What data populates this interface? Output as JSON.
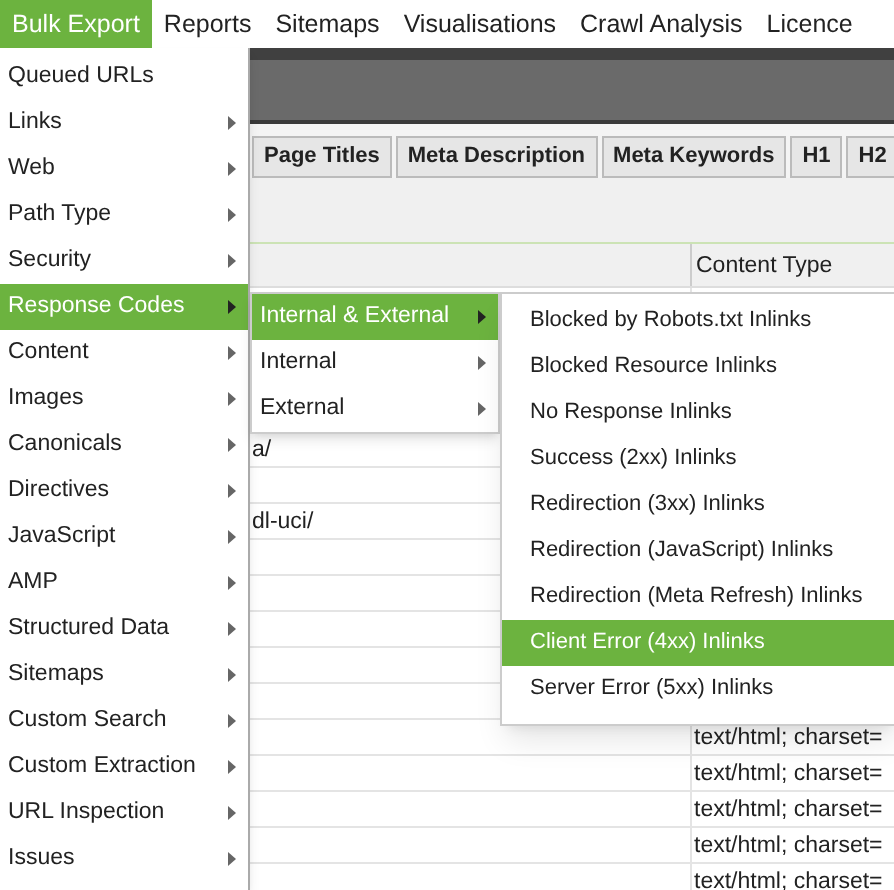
{
  "menu_bar": [
    {
      "label": "Bulk Export",
      "selected": true
    },
    {
      "label": "Reports",
      "selected": false
    },
    {
      "label": "Sitemaps",
      "selected": false
    },
    {
      "label": "Visualisations",
      "selected": false
    },
    {
      "label": "Crawl Analysis",
      "selected": false
    },
    {
      "label": "Licence",
      "selected": false
    }
  ],
  "tabs": [
    {
      "label": "Page Titles"
    },
    {
      "label": "Meta Description"
    },
    {
      "label": "Meta Keywords"
    },
    {
      "label": "H1"
    },
    {
      "label": "H2"
    }
  ],
  "table": {
    "columns": [
      {
        "label": "Content Type"
      }
    ],
    "rows": [
      {},
      {},
      {},
      {},
      {
        "column_1": "a/"
      },
      {},
      {
        "column_1": "dl-uci/"
      },
      {},
      {},
      {},
      {},
      {},
      {
        "content_type": "text/html; charset="
      },
      {
        "content_type": "text/html; charset="
      },
      {
        "content_type": "text/html; charset="
      },
      {
        "content_type": "text/html; charset="
      },
      {
        "content_type": "text/html; charset="
      }
    ]
  },
  "bulk_export_menu": [
    {
      "label": "Queued URLs",
      "submenu": false,
      "selected": false
    },
    {
      "label": "Links",
      "submenu": true,
      "selected": false
    },
    {
      "label": "Web",
      "submenu": true,
      "selected": false
    },
    {
      "label": "Path Type",
      "submenu": true,
      "selected": false
    },
    {
      "label": "Security",
      "submenu": true,
      "selected": false
    },
    {
      "label": "Response Codes",
      "submenu": true,
      "selected": true
    },
    {
      "label": "Content",
      "submenu": true,
      "selected": false
    },
    {
      "label": "Images",
      "submenu": true,
      "selected": false
    },
    {
      "label": "Canonicals",
      "submenu": true,
      "selected": false
    },
    {
      "label": "Directives",
      "submenu": true,
      "selected": false
    },
    {
      "label": "JavaScript",
      "submenu": true,
      "selected": false
    },
    {
      "label": "AMP",
      "submenu": true,
      "selected": false
    },
    {
      "label": "Structured Data",
      "submenu": true,
      "selected": false
    },
    {
      "label": "Sitemaps",
      "submenu": true,
      "selected": false
    },
    {
      "label": "Custom Search",
      "submenu": true,
      "selected": false
    },
    {
      "label": "Custom Extraction",
      "submenu": true,
      "selected": false
    },
    {
      "label": "URL Inspection",
      "submenu": true,
      "selected": false
    },
    {
      "label": "Issues",
      "submenu": true,
      "selected": false
    }
  ],
  "response_codes_submenu": [
    {
      "label": "Internal & External",
      "submenu": true,
      "selected": true
    },
    {
      "label": "Internal",
      "submenu": true,
      "selected": false
    },
    {
      "label": "External",
      "submenu": true,
      "selected": false
    }
  ],
  "inlinks_submenu": [
    {
      "label": "Blocked by Robots.txt Inlinks",
      "submenu": false,
      "selected": false
    },
    {
      "label": "Blocked Resource Inlinks",
      "submenu": false,
      "selected": false
    },
    {
      "label": "No Response Inlinks",
      "submenu": false,
      "selected": false
    },
    {
      "label": "Success (2xx) Inlinks",
      "submenu": false,
      "selected": false
    },
    {
      "label": "Redirection (3xx) Inlinks",
      "submenu": false,
      "selected": false
    },
    {
      "label": "Redirection (JavaScript) Inlinks",
      "submenu": false,
      "selected": false
    },
    {
      "label": "Redirection (Meta Refresh) Inlinks",
      "submenu": false,
      "selected": false
    },
    {
      "label": "Client Error (4xx) Inlinks",
      "submenu": false,
      "selected": true
    },
    {
      "label": "Server Error (5xx) Inlinks",
      "submenu": false,
      "selected": false
    }
  ]
}
